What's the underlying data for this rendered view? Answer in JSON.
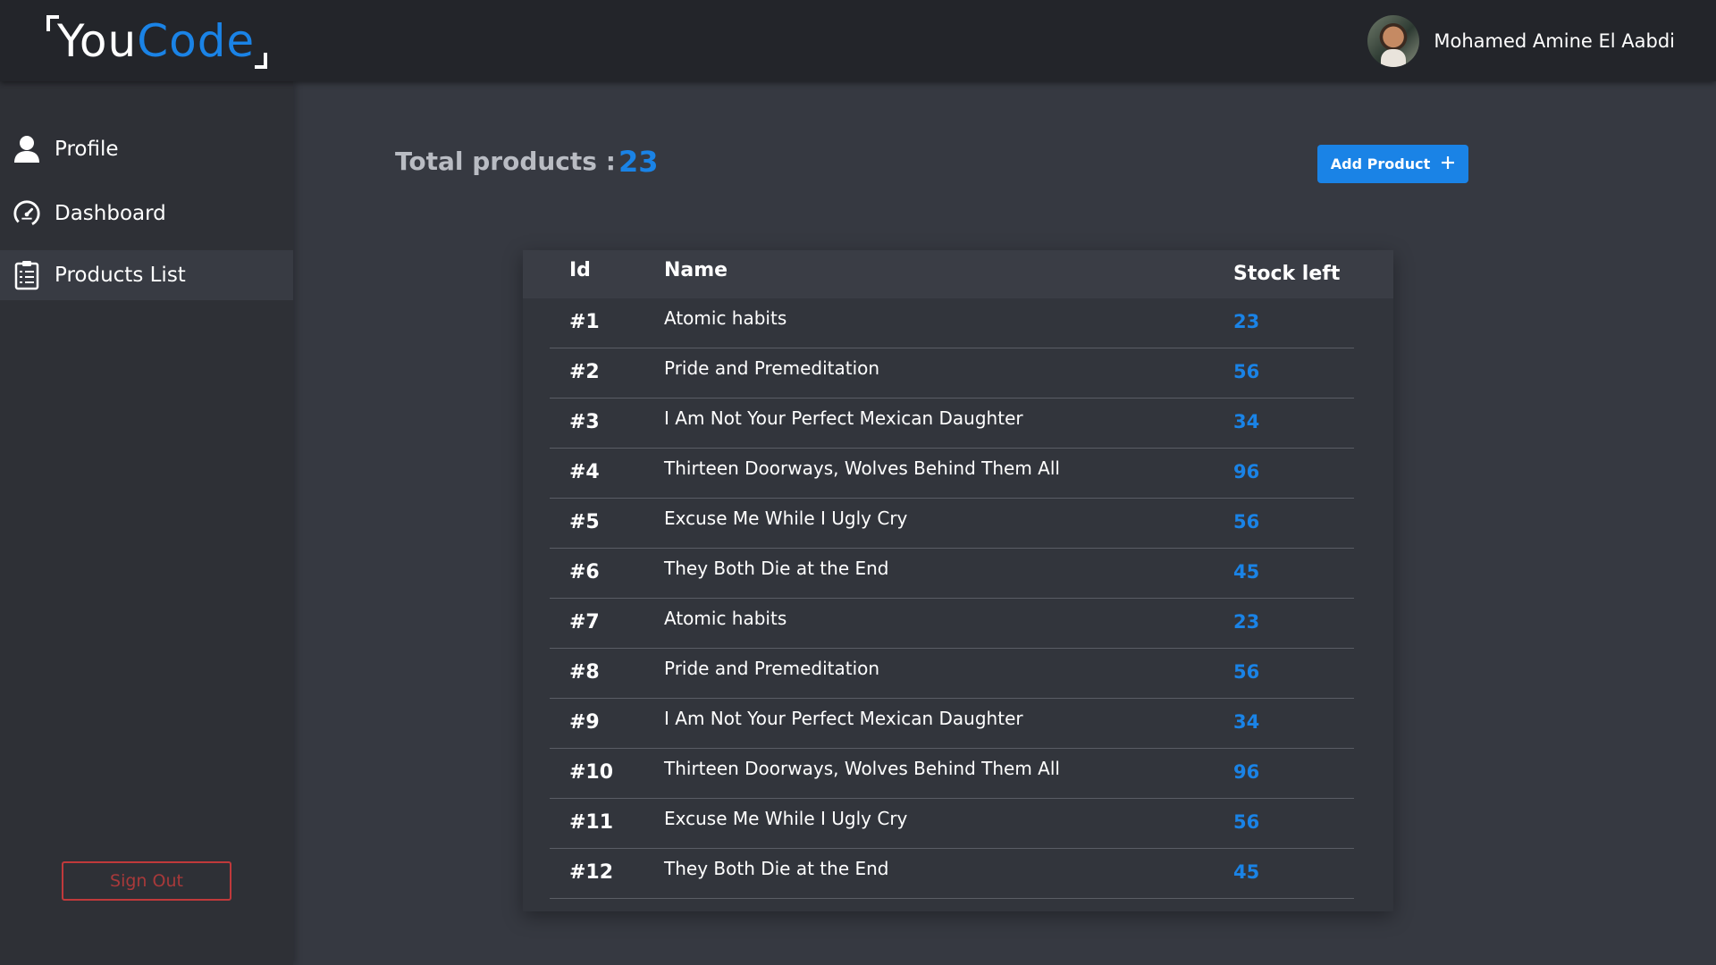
{
  "header": {
    "logo": {
      "part1": "You",
      "part2": "Code"
    },
    "user_name": "Mohamed Amine El Aabdi"
  },
  "sidebar": {
    "items": [
      {
        "label": "Profile",
        "icon": "user-icon"
      },
      {
        "label": "Dashboard",
        "icon": "speedometer-icon"
      },
      {
        "label": "Products List",
        "icon": "clipboard-list-icon",
        "active": true
      }
    ],
    "sign_out": "Sign Out"
  },
  "summary": {
    "total_label": "Total products :",
    "total_value": "23",
    "add_button": "Add Product"
  },
  "table": {
    "headers": {
      "id": "Id",
      "name": "Name",
      "stock": "Stock left"
    },
    "rows": [
      {
        "id": "#1",
        "name": "Atomic habits",
        "stock": "23"
      },
      {
        "id": "#2",
        "name": "Pride and Premeditation",
        "stock": "56"
      },
      {
        "id": "#3",
        "name": "I Am Not Your Perfect Mexican Daughter",
        "stock": "34"
      },
      {
        "id": "#4",
        "name": "Thirteen Doorways, Wolves Behind Them All",
        "stock": "96"
      },
      {
        "id": "#5",
        "name": "Excuse Me While I Ugly Cry",
        "stock": "56"
      },
      {
        "id": "#6",
        "name": "They Both Die at the End",
        "stock": "45"
      },
      {
        "id": "#7",
        "name": "Atomic habits",
        "stock": "23"
      },
      {
        "id": "#8",
        "name": "Pride and Premeditation",
        "stock": "56"
      },
      {
        "id": "#9",
        "name": "I Am Not Your Perfect Mexican Daughter",
        "stock": "34"
      },
      {
        "id": "#10",
        "name": "Thirteen Doorways, Wolves Behind Them All",
        "stock": "96"
      },
      {
        "id": "#11",
        "name": "Excuse Me While I Ugly Cry",
        "stock": "56"
      },
      {
        "id": "#12",
        "name": "They Both Die at the End",
        "stock": "45"
      }
    ]
  },
  "colors": {
    "accent": "#1a83e6",
    "danger": "#c0393b",
    "topbar": "#23252a",
    "sidebar": "#2e3036",
    "background": "#363941"
  }
}
